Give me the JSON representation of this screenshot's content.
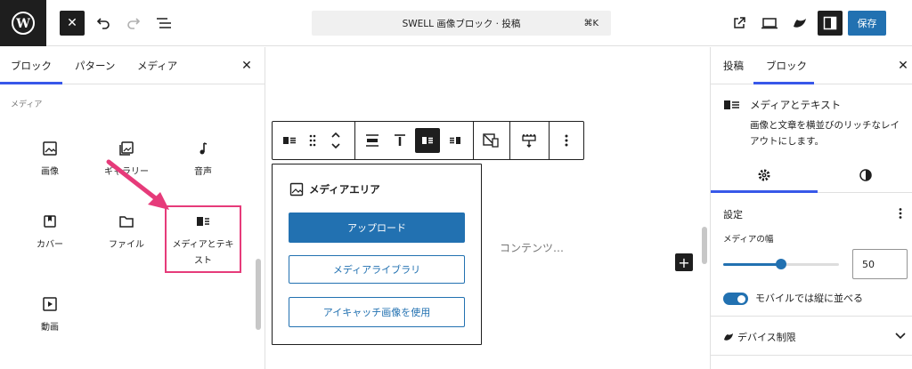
{
  "topbar": {
    "close_label": "✕",
    "command_title": "SWELL 画像ブロック · 投稿",
    "command_shortcut": "⌘K",
    "save_label": "保存",
    "icons": [
      "wordpress-logo-icon",
      "close-icon",
      "undo-icon",
      "redo-icon",
      "list-view-icon",
      "external-link-icon",
      "preview-icon",
      "swell-icon",
      "sidebar-icon"
    ]
  },
  "inserter": {
    "tabs": [
      "ブロック",
      "パターン",
      "メディア"
    ],
    "category": "メディア",
    "blocks": [
      {
        "label": "画像",
        "icon": "image-icon"
      },
      {
        "label": "ギャラリー",
        "icon": "gallery-icon"
      },
      {
        "label": "音声",
        "icon": "audio-icon"
      },
      {
        "label": "カバー",
        "icon": "cover-icon"
      },
      {
        "label": "ファイル",
        "icon": "file-icon"
      },
      {
        "label": "メディアとテキスト",
        "icon": "media-text-icon"
      },
      {
        "label": "動画",
        "icon": "video-icon"
      }
    ],
    "highlight_color": "#e63b7a"
  },
  "canvas": {
    "media_area_title": "メディアエリア",
    "upload_label": "アップロード",
    "library_label": "メディアライブラリ",
    "featured_label": "アイキャッチ画像を使用",
    "content_placeholder": "コンテンツ…",
    "add_label": "+"
  },
  "settings": {
    "tabs": [
      "投稿",
      "ブロック"
    ],
    "block_title": "メディアとテキスト",
    "block_description": "画像と文章を横並びのリッチなレイアウトにします。",
    "section_title": "設定",
    "media_width_label": "メディアの幅",
    "media_width_value": "50",
    "media_width_fraction": 0.5,
    "mobile_stack_label": "モバイルでは縦に並べる",
    "mobile_stack_enabled": true,
    "device_label": "デバイス制限"
  },
  "colors": {
    "accent": "#2271b1",
    "tab_underline": "#3858e9",
    "dark": "#1e1e1e",
    "highlight": "#e63b7a"
  }
}
